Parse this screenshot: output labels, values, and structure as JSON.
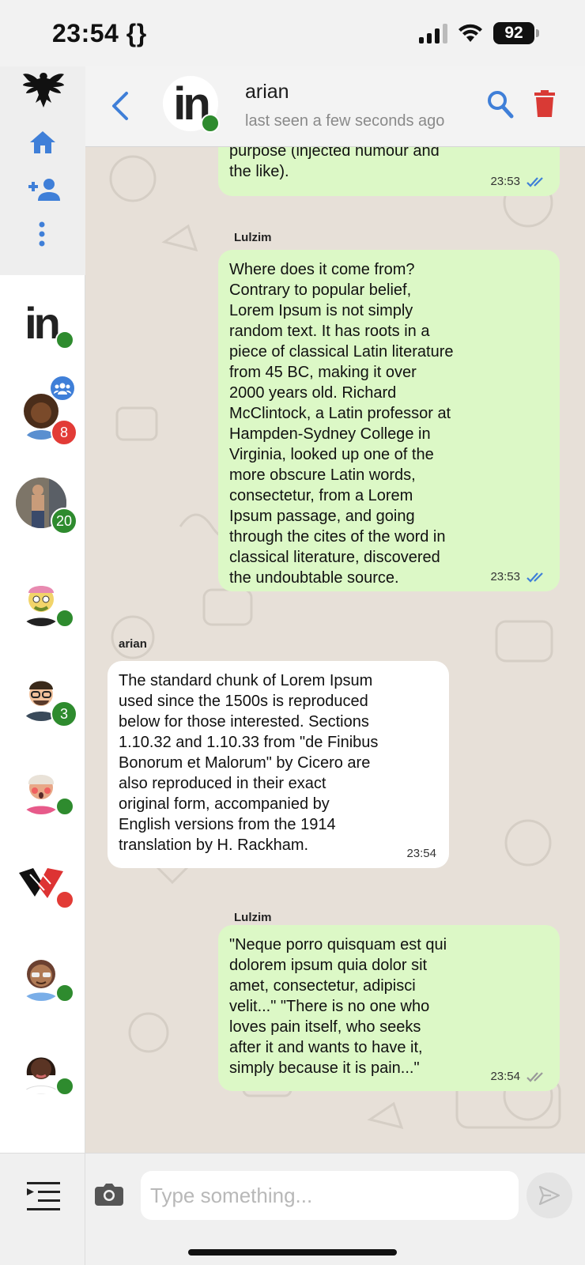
{
  "status_bar": {
    "time": "23:54 {}",
    "battery": "92"
  },
  "colors": {
    "accent": "#3f7fd8",
    "outgoing_bubble": "#dcf8c6",
    "incoming_bubble": "#ffffff",
    "online": "#2e8b2e",
    "unread_red": "#e23b36",
    "delete_red": "#d93a35"
  },
  "sidebar": {
    "icons": [
      "eagle-logo-icon",
      "home-icon",
      "add-contact-icon",
      "more-vertical-icon"
    ],
    "chats": [
      {
        "name": "chat-in-logo",
        "online": true
      },
      {
        "name": "chat-group-woman",
        "badge": "8",
        "badge_color": "#e23b36",
        "group": true
      },
      {
        "name": "chat-gym-man",
        "badge": "20",
        "badge_color": "#2e8b2e"
      },
      {
        "name": "chat-yellow-face",
        "online": true
      },
      {
        "name": "chat-glasses-man",
        "badge": "3",
        "badge_color": "#2e8b2e"
      },
      {
        "name": "chat-blush-face",
        "online": true
      },
      {
        "name": "chat-hands-logo",
        "unread": true
      },
      {
        "name": "chat-sunglasses-woman",
        "online": true
      },
      {
        "name": "chat-dark-woman",
        "online": true
      }
    ],
    "bottom_icon": "menu-indent-icon"
  },
  "header": {
    "name": "arian",
    "status": "last seen a few seconds ago"
  },
  "messages": [
    {
      "sender": "",
      "text": "purpose (injected humour and\nthe like).",
      "time": "23:53"
    },
    {
      "sender": "Lulzim",
      "text": "Where does it come from?\nContrary to popular belief,\nLorem Ipsum is not simply\nrandom text. It has roots in a\npiece of classical Latin literature\nfrom 45 BC, making it over\n2000 years old. Richard\nMcClintock, a Latin professor at\nHampden-Sydney College in\nVirginia, looked up one of the\nmore obscure Latin words,\nconsectetur, from a Lorem\nIpsum passage, and going\nthrough the cites of the word in\nclassical literature, discovered\nthe undoubtable source.",
      "time": "23:53"
    },
    {
      "sender": "arian",
      "text": "The standard chunk of Lorem Ipsum\nused since the 1500s is reproduced\nbelow for those interested. Sections\n1.10.32 and 1.10.33 from \"de Finibus\nBonorum et Malorum\" by Cicero are\nalso reproduced in their exact\noriginal form, accompanied by\nEnglish versions from the 1914\ntranslation by H. Rackham.",
      "time": "23:54"
    },
    {
      "sender": "Lulzim",
      "text": "\"Neque porro quisquam est qui\ndolorem ipsum quia dolor sit\namet, consectetur, adipisci\nvelit...\" \"There is no one who\nloves pain itself, who seeks\nafter it and wants to have it,\nsimply because it is pain...\"",
      "time": "23:54"
    }
  ],
  "composer": {
    "placeholder": "Type something..."
  }
}
